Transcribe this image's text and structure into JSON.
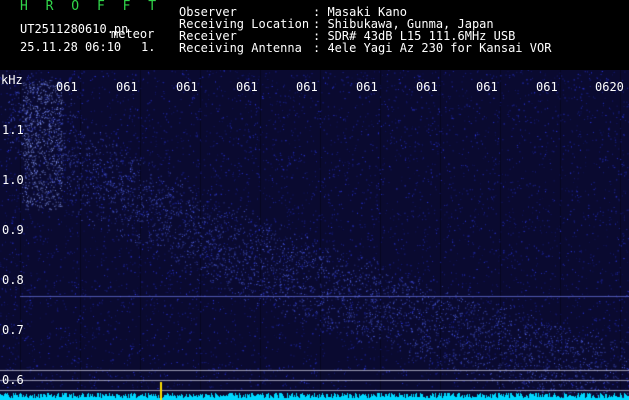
{
  "app": {
    "title": "H R O F F T"
  },
  "file": {
    "name": "UT2511280610.pn",
    "tag": "meteor",
    "datetime": "25.11.28 06:10",
    "index": "1."
  },
  "station": {
    "labels": [
      "Observer",
      "Receiving Location",
      "Receiver",
      "Receiving Antenna"
    ],
    "values": [
      ": Masaki Kano",
      ": Shibukawa, Gunma, Japan",
      ": SDR# 43dB L15 111.6MHz USB",
      ": 4ele Yagi Az 230 for Kansai VOR"
    ]
  },
  "plot": {
    "unit": "kHz",
    "x_ticks": [
      "061",
      "061",
      "061",
      "061",
      "061",
      "061",
      "061",
      "061",
      "061",
      "0620"
    ],
    "y_ticks": [
      "1.1",
      "1.0",
      "0.9",
      "0.8",
      "0.7",
      "0.6"
    ]
  },
  "colors": {
    "title": "#31d64a",
    "background": "#0a0a30",
    "signal": "#1f2cd8",
    "baseline": "#00d8ff",
    "marker": "#ffe000"
  }
}
